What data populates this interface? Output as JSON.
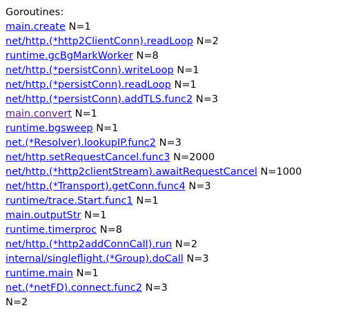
{
  "header": "Goroutines:",
  "goroutines": [
    {
      "name": "main.create",
      "count": "N=1",
      "visited": false
    },
    {
      "name": "net/http.(*http2ClientConn).readLoop",
      "count": "N=2",
      "visited": false
    },
    {
      "name": "runtime.gcBgMarkWorker",
      "count": "N=8",
      "visited": false
    },
    {
      "name": "net/http.(*persistConn).writeLoop",
      "count": "N=1",
      "visited": false
    },
    {
      "name": "net/http.(*persistConn).readLoop",
      "count": "N=1",
      "visited": false
    },
    {
      "name": "net/http.(*persistConn).addTLS.func2",
      "count": "N=3",
      "visited": false
    },
    {
      "name": "main.convert",
      "count": "N=1",
      "visited": true
    },
    {
      "name": "runtime.bgsweep",
      "count": "N=1",
      "visited": false
    },
    {
      "name": "net.(*Resolver).lookupIP.func2",
      "count": "N=3",
      "visited": false
    },
    {
      "name": "net/http.setRequestCancel.func3",
      "count": "N=2000",
      "visited": false
    },
    {
      "name": "net/http.(*http2clientStream).awaitRequestCancel",
      "count": "N=1000",
      "visited": false
    },
    {
      "name": "net/http.(*Transport).getConn.func4",
      "count": "N=3",
      "visited": false
    },
    {
      "name": "runtime/trace.Start.func1",
      "count": "N=1",
      "visited": false
    },
    {
      "name": "main.outputStr",
      "count": "N=1",
      "visited": false
    },
    {
      "name": "runtime.timerproc",
      "count": "N=8",
      "visited": false
    },
    {
      "name": "net/http.(*http2addConnCall).run",
      "count": "N=2",
      "visited": false
    },
    {
      "name": "internal/singleflight.(*Group).doCall",
      "count": "N=3",
      "visited": false
    },
    {
      "name": "runtime.main",
      "count": "N=1",
      "visited": false
    },
    {
      "name": "net.(*netFD).connect.func2",
      "count": "N=3",
      "visited": false
    }
  ],
  "footer": "N=2",
  "colors": {
    "link": "#0000ee",
    "visited_link": "#551a8b",
    "text": "#000000",
    "background": "#ffffff"
  }
}
